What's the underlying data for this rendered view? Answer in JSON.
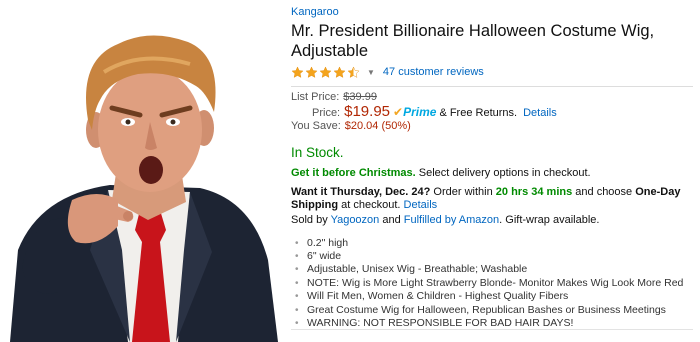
{
  "product": {
    "brand": "Kangaroo",
    "title": "Mr. President Billionaire Halloween Costume Wig, Adjustable",
    "rating_stars": 4.5,
    "reviews_label": "47 customer reviews"
  },
  "pricing": {
    "list_price_label": "List Price:",
    "list_price_value": "$39.99",
    "price_label": "Price:",
    "price_value": "$19.95",
    "prime_label": "Prime",
    "free_returns": "& Free Returns.",
    "details_link": "Details",
    "save_label": "You Save:",
    "save_value": "$20.04 (50%)"
  },
  "availability": {
    "status": "In Stock.",
    "christmas_bold": "Get it before Christmas.",
    "christmas_rest": "Select delivery options in checkout.",
    "want_it_bold": "Want it Thursday, Dec. 24?",
    "order_within": "Order within",
    "countdown": "20 hrs 34 mins",
    "and_choose": "and choose",
    "shipping_option": "One-Day Shipping",
    "at": "at",
    "checkout": "checkout.",
    "details_link": "Details",
    "sold_by": "Sold by",
    "seller": "Yagoozon",
    "and": "and",
    "fulfilled": "Fulfilled by Amazon",
    "gift_wrap": ". Gift-wrap available."
  },
  "features": [
    "0.2\" high",
    "6\" wide",
    "Adjustable, Unisex Wig - Breathable; Washable",
    "NOTE: Wig is More Light Strawberry Blonde- Monitor Makes Wig Look More Red",
    "Will Fit Men, Women & Children - Highest Quality Fibers",
    "Great Costume Wig for Halloween, Republican Bashes or Business Meetings",
    "WARNING: NOT RESPONSIBLE FOR BAD HAIR DAYS!"
  ],
  "colors": {
    "link": "#0066c0",
    "price": "#b12704",
    "in_stock": "#008a00",
    "star": "#f4a41d",
    "prime_blue": "#00a8e1"
  }
}
